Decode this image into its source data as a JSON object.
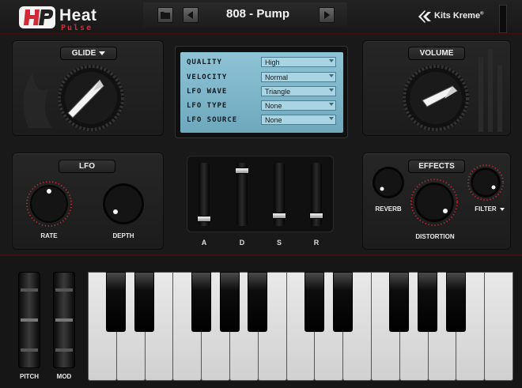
{
  "header": {
    "logo_title": "Heat",
    "logo_subtitle": "Pulse",
    "preset_name": "808 - Pump",
    "brand": "Kits Kreme"
  },
  "glide": {
    "label": "GLIDE"
  },
  "volume": {
    "label": "VOLUME"
  },
  "display": {
    "rows": [
      {
        "label": "QUALITY",
        "value": "High"
      },
      {
        "label": "VELOCITY",
        "value": "Normal"
      },
      {
        "label": "LFO WAVE",
        "value": "Triangle"
      },
      {
        "label": "LFO TYPE",
        "value": "None"
      },
      {
        "label": "LFO SOURCE",
        "value": "None"
      }
    ]
  },
  "lfo": {
    "label": "LFO",
    "rate_label": "RATE",
    "depth_label": "DEPTH"
  },
  "adsr": {
    "attack": {
      "label": "A",
      "level": 0.1
    },
    "decay": {
      "label": "D",
      "level": 0.95
    },
    "sustain": {
      "label": "S",
      "level": 0.15
    },
    "release": {
      "label": "R",
      "level": 0.15
    }
  },
  "effects": {
    "label": "EFFECTS",
    "reverb_label": "REVERB",
    "distortion_label": "DISTORTION",
    "filter_label": "FILTER"
  },
  "wheels": {
    "pitch_label": "PITCH",
    "mod_label": "MOD"
  },
  "colors": {
    "accent": "#d42a35",
    "screen": "#7fb6ca"
  }
}
